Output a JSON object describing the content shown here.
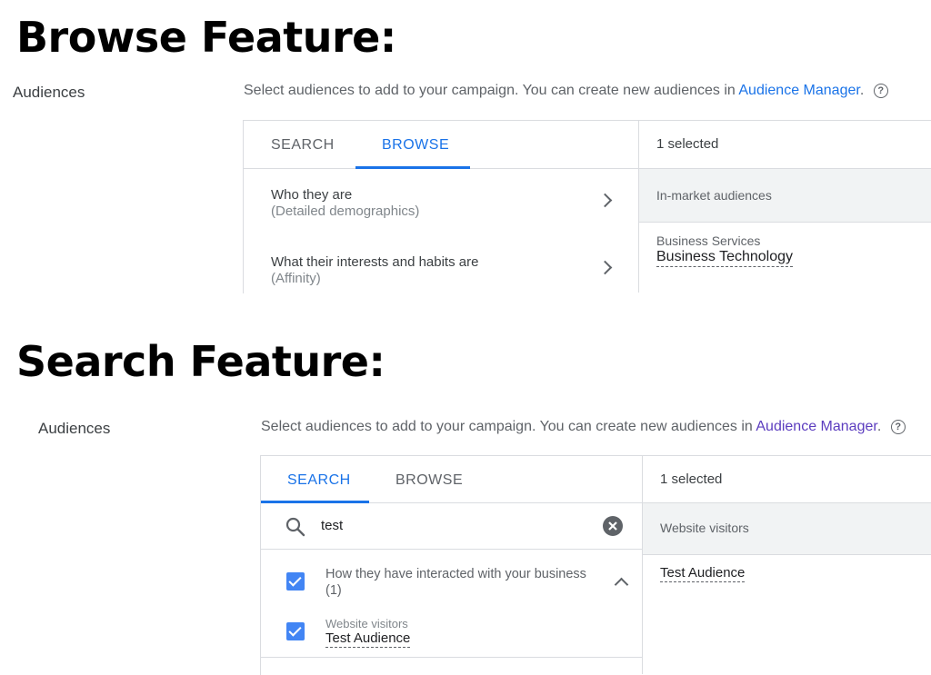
{
  "browse_section": {
    "heading": "Browse Feature:",
    "label": "Audiences",
    "description_prefix": "Select audiences to add to your campaign. You can create new audiences in",
    "description_link": "Audience Manager",
    "description_suffix": ".",
    "help_icon": "help-circle-icon",
    "tabs": [
      {
        "label": "SEARCH",
        "active": false
      },
      {
        "label": "BROWSE",
        "active": true
      }
    ],
    "categories": [
      {
        "title": "Who they are",
        "subtitle": "(Detailed demographics)"
      },
      {
        "title": "What their interests and habits are",
        "subtitle": "(Affinity)"
      }
    ],
    "selected_count": "1 selected",
    "selected_group": "In-market audiences",
    "selected_item_parent": "Business Services",
    "selected_item": "Business Technology"
  },
  "search_section": {
    "heading": "Search Feature:",
    "label": "Audiences",
    "description_prefix": "Select audiences to add to your campaign. You can create new audiences in",
    "description_link": "Audience Manager",
    "description_suffix": ".",
    "help_icon": "help-circle-icon",
    "tabs": [
      {
        "label": "SEARCH",
        "active": true
      },
      {
        "label": "BROWSE",
        "active": false
      }
    ],
    "search_value": "test",
    "result_group": {
      "title": "How they have interacted with your business",
      "count": "(1)",
      "checked": true
    },
    "result_item": {
      "category": "Website visitors",
      "name": "Test Audience",
      "checked": true
    },
    "selected_count": "1 selected",
    "selected_group": "Website visitors",
    "selected_item": "Test Audience"
  },
  "colors": {
    "accent": "#1a73e8",
    "checkbox": "#4285f4",
    "link_visited": "#5c3dbf"
  }
}
